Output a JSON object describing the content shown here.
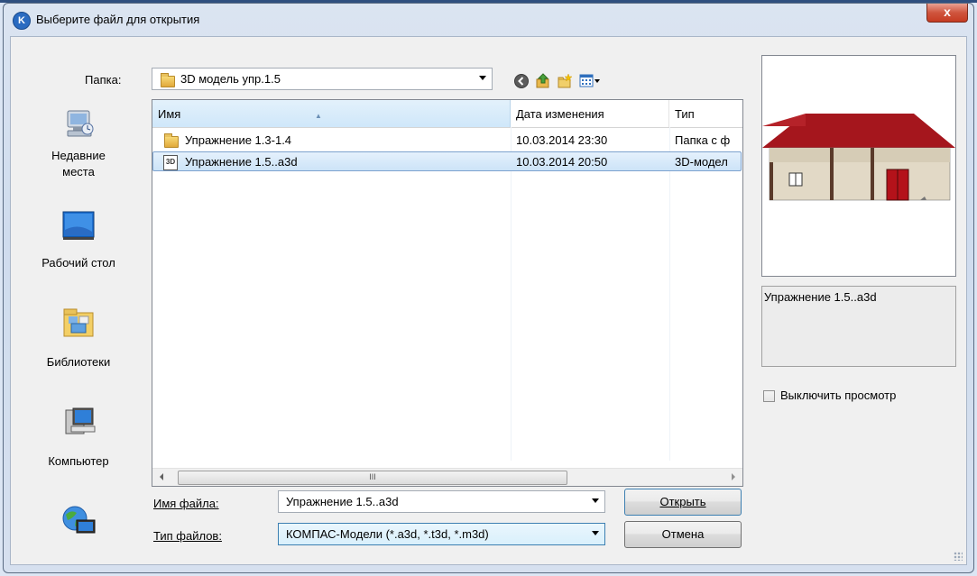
{
  "window": {
    "title": "Выберите файл для открытия",
    "close_label": "x"
  },
  "folder": {
    "label": "Папка:",
    "value": "3D модель упр.1.5"
  },
  "places": [
    {
      "label": "Недавние места",
      "icon": "recent-places-icon"
    },
    {
      "label": "Рабочий стол",
      "icon": "desktop-icon"
    },
    {
      "label": "Библиотеки",
      "icon": "libraries-icon"
    },
    {
      "label": "Компьютер",
      "icon": "computer-icon"
    },
    {
      "label": "",
      "icon": "network-icon"
    }
  ],
  "columns": {
    "name": "Имя",
    "date": "Дата изменения",
    "type": "Тип"
  },
  "files": [
    {
      "name": "Упражнение 1.3-1.4",
      "date": "10.03.2014 23:30",
      "type": "Папка с ф",
      "icon": "folder-icon"
    },
    {
      "name": "Упражнение 1.5..a3d",
      "date": "10.03.2014 20:50",
      "type": "3D-модел",
      "icon": "3d-file-icon",
      "selected": true
    }
  ],
  "scrollbar": {
    "thumb_grip": "III"
  },
  "filename": {
    "label": "Имя файла:",
    "value": "Упражнение 1.5..a3d"
  },
  "filetype": {
    "label": "Тип файлов:",
    "value": "КОМПАС-Модели (*.a3d, *.t3d, *.m3d)"
  },
  "buttons": {
    "open": "Открыть",
    "cancel": "Отмена"
  },
  "preview": {
    "filename": "Упражнение 1.5..a3d",
    "disable_label": "Выключить просмотр"
  },
  "colors": {
    "roof": "#a5161d",
    "wall": "#e2d9c6",
    "door": "#b4121a",
    "selection": "#cce3f8"
  }
}
